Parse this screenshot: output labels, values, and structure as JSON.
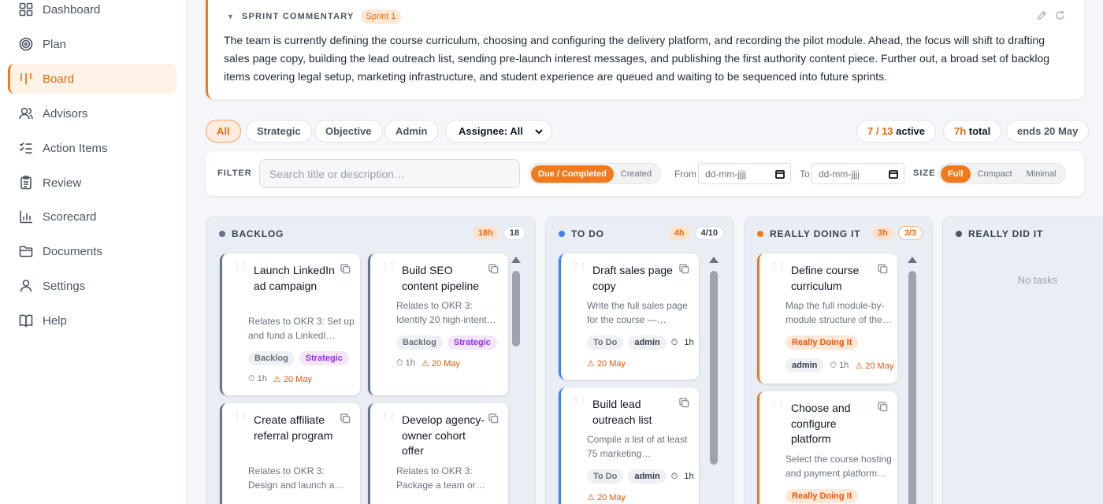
{
  "sidebar": {
    "items": [
      {
        "label": "Dashboard",
        "icon": "grid-icon"
      },
      {
        "label": "Plan",
        "icon": "target-icon"
      },
      {
        "label": "Board",
        "icon": "board-icon",
        "active": true
      },
      {
        "label": "Advisors",
        "icon": "users-icon"
      },
      {
        "label": "Action Items",
        "icon": "checklist-icon"
      },
      {
        "label": "Review",
        "icon": "clipboard-icon"
      },
      {
        "label": "Scorecard",
        "icon": "bar-chart-icon"
      },
      {
        "label": "Documents",
        "icon": "folder-icon"
      },
      {
        "label": "Settings",
        "icon": "user-icon"
      },
      {
        "label": "Help",
        "icon": "book-icon"
      }
    ]
  },
  "commentary": {
    "caret": "▼",
    "title": "SPRINT COMMENTARY",
    "sprint": "Sprint 1",
    "body": "The team is currently defining the course curriculum, choosing and configuring the delivery platform, and recording the pilot module. Ahead, the focus will shift to drafting sales page copy, building the lead outreach list, sending pre-launch interest messages, and publishing the first authority content piece. Further out, a broad set of backlog items covering legal setup, marketing infrastructure, and student experience are queued and waiting to be sequenced into future sprints."
  },
  "chips": {
    "all": "All",
    "strategic": "Strategic",
    "objective": "Objective",
    "admin": "Admin",
    "assignee": "Assignee: All",
    "active_a": "7",
    "active_sep": " / ",
    "active_b": "13",
    "active_label": " active",
    "total_h": "7h",
    "total_label": " total",
    "ends": "ends 20 May"
  },
  "filter": {
    "label": "FILTER",
    "search_placeholder": "Search title or description…",
    "mode_due": "Due / Completed",
    "mode_created": "Created",
    "from_label": "From",
    "to_label": "To",
    "date_placeholder": "dd-mm-jjjj",
    "size_label": "SIZE",
    "size_full": "Full",
    "size_compact": "Compact",
    "size_minimal": "Minimal"
  },
  "columns": [
    {
      "title": "BACKLOG",
      "dot": "#64748b",
      "hours": "18h",
      "count": "18",
      "cards": [
        {
          "title": "Launch LinkedIn ad campaign",
          "desc": "Relates to OKR 3: Set up and fund a LinkedI…",
          "tags": [
            "Backlog",
            "Strategic"
          ],
          "time": "1h",
          "due": "20 May"
        },
        {
          "title": "Build SEO content pipeline",
          "desc": "Relates to OKR 3: Identify 20 high-intent…",
          "tags": [
            "Backlog",
            "Strategic"
          ],
          "time": "1h",
          "due": "20 May"
        },
        {
          "title": "Create affiliate referral program",
          "desc": "Relates to OKR 3: Design and launch a…"
        },
        {
          "title": "Develop agency-owner cohort offer",
          "desc": "Relates to OKR 3: Package a team or…"
        }
      ]
    },
    {
      "title": "TO DO",
      "dot": "#3b82f6",
      "hours": "4h",
      "count": "4/10",
      "cards": [
        {
          "title": "Draft sales page copy",
          "desc": "Write the full sales page for the course —…",
          "status": "To Do",
          "assignee": "admin",
          "time": "1h",
          "due": "20 May"
        },
        {
          "title": "Build lead outreach list",
          "desc": "Compile a list of at least 75 marketing…",
          "status": "To Do",
          "assignee": "admin",
          "time": "1h",
          "due": "20 May"
        }
      ]
    },
    {
      "title": "REALLY DOING IT",
      "dot": "#f07a1e",
      "hours": "3h",
      "count": "3/3",
      "cards": [
        {
          "title": "Define course curriculum",
          "desc": "Map the full module-by-module structure of the…",
          "status": "Really Doing It",
          "assignee": "admin",
          "time": "1h",
          "due": "20 May"
        },
        {
          "title": "Choose and configure platform",
          "desc": "Select the course hosting and payment platform…",
          "status": "Really Doing It"
        }
      ]
    },
    {
      "title": "REALLY DID IT",
      "dot": "#4b5563",
      "empty": "No tasks"
    }
  ]
}
